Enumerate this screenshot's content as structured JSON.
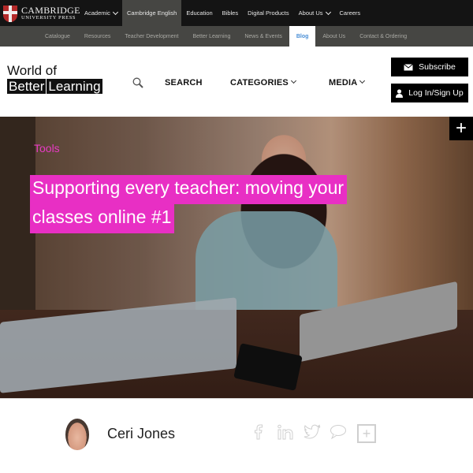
{
  "topbar": {
    "brand_line1": "CAMBRIDGE",
    "brand_line2": "UNIVERSITY PRESS",
    "items": [
      {
        "label": "Academic",
        "dropdown": true
      },
      {
        "label": "Cambridge English",
        "active": true
      },
      {
        "label": "Education"
      },
      {
        "label": "Bibles"
      },
      {
        "label": "Digital Products"
      },
      {
        "label": "About Us",
        "dropdown": true
      },
      {
        "label": "Careers"
      }
    ]
  },
  "subnav": {
    "items": [
      {
        "label": "Catalogue"
      },
      {
        "label": "Resources"
      },
      {
        "label": "Teacher Development"
      },
      {
        "label": "Better Learning"
      },
      {
        "label": "News & Events"
      },
      {
        "label": "Blog",
        "active": true
      },
      {
        "label": "About Us"
      },
      {
        "label": "Contact & Ordering"
      }
    ]
  },
  "header": {
    "logo_line1": "World of",
    "logo_word1": "Better",
    "logo_word2": "Learning",
    "search_label": "SEARCH",
    "categories_label": "CATEGORIES",
    "media_label": "MEDIA",
    "subscribe_label": "Subscribe",
    "login_label": "Log In/Sign Up"
  },
  "hero": {
    "tag": "Tools",
    "title_line1": "Supporting every teacher: moving your",
    "title_line2": "classes online #1",
    "plus_label": "+",
    "accent_color": "#e82fc4"
  },
  "author": {
    "name": "Ceri Jones",
    "share_icons": [
      "facebook-icon",
      "linkedin-icon",
      "twitter-icon",
      "comment-icon",
      "plus-icon"
    ],
    "share_plus_label": "+"
  }
}
